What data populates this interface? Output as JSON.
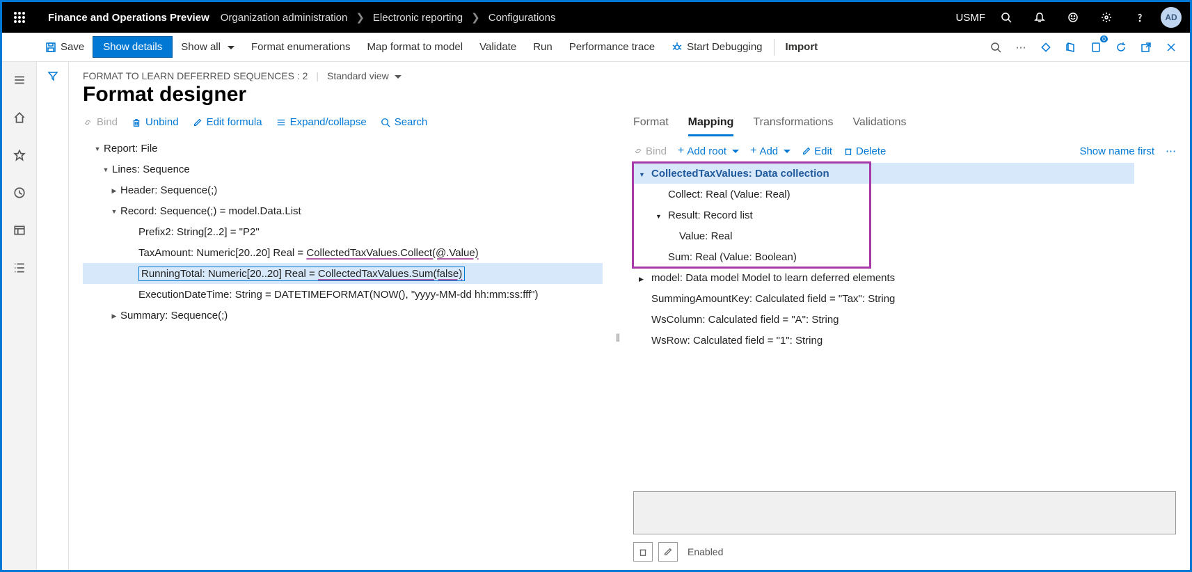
{
  "topbar": {
    "title": "Finance and Operations Preview",
    "crumbs": [
      "Organization administration",
      "Electronic reporting",
      "Configurations"
    ],
    "entity": "USMF",
    "avatar": "AD"
  },
  "cmdbar": {
    "save": "Save",
    "showDetails": "Show details",
    "showAll": "Show all",
    "formatEnum": "Format enumerations",
    "mapFormat": "Map format to model",
    "validate": "Validate",
    "run": "Run",
    "perfTrace": "Performance trace",
    "startDebug": "Start Debugging",
    "import": "Import"
  },
  "breadcrumb": {
    "context": "FORMAT TO LEARN DEFERRED SEQUENCES : 2",
    "view": "Standard view"
  },
  "pageTitle": "Format designer",
  "subtoolbar": {
    "bind": "Bind",
    "unbind": "Unbind",
    "editFormula": "Edit formula",
    "expandCollapse": "Expand/collapse",
    "search": "Search"
  },
  "leftTree": {
    "n0": "Report: File",
    "n1": "Lines: Sequence",
    "n2": "Header: Sequence(;)",
    "n3": "Record: Sequence(;) = model.Data.List",
    "n4": "Prefix2: String[2..2] = \"P2\"",
    "n5a": "TaxAmount: Numeric[20..20] Real = ",
    "n5b": "CollectedTaxValues.Collect(@.Value)",
    "n6a": "RunningTotal: Numeric[20..20] Real = ",
    "n6b": "CollectedTaxValues.Sum(false)",
    "n7": "ExecutionDateTime: String = DATETIMEFORMAT(NOW(), \"yyyy-MM-dd hh:mm:ss:fff\")",
    "n8": "Summary: Sequence(;)"
  },
  "tabs": {
    "format": "Format",
    "mapping": "Mapping",
    "transformations": "Transformations",
    "validations": "Validations"
  },
  "rightToolbar": {
    "bind": "Bind",
    "addRoot": "Add root",
    "add": "Add",
    "edit": "Edit",
    "delete": "Delete",
    "showName": "Show name first"
  },
  "rightTree": {
    "r0": "CollectedTaxValues: Data collection",
    "r1": "Collect: Real (Value: Real)",
    "r2": "Result: Record list",
    "r3": "Value: Real",
    "r4": "Sum: Real (Value: Boolean)",
    "r5": "model: Data model Model to learn deferred elements",
    "r6": "SummingAmountKey: Calculated field = \"Tax\": String",
    "r7": "WsColumn: Calculated field = \"A\": String",
    "r8": "WsRow: Calculated field = \"1\": String"
  },
  "bottom": {
    "enabled": "Enabled"
  }
}
